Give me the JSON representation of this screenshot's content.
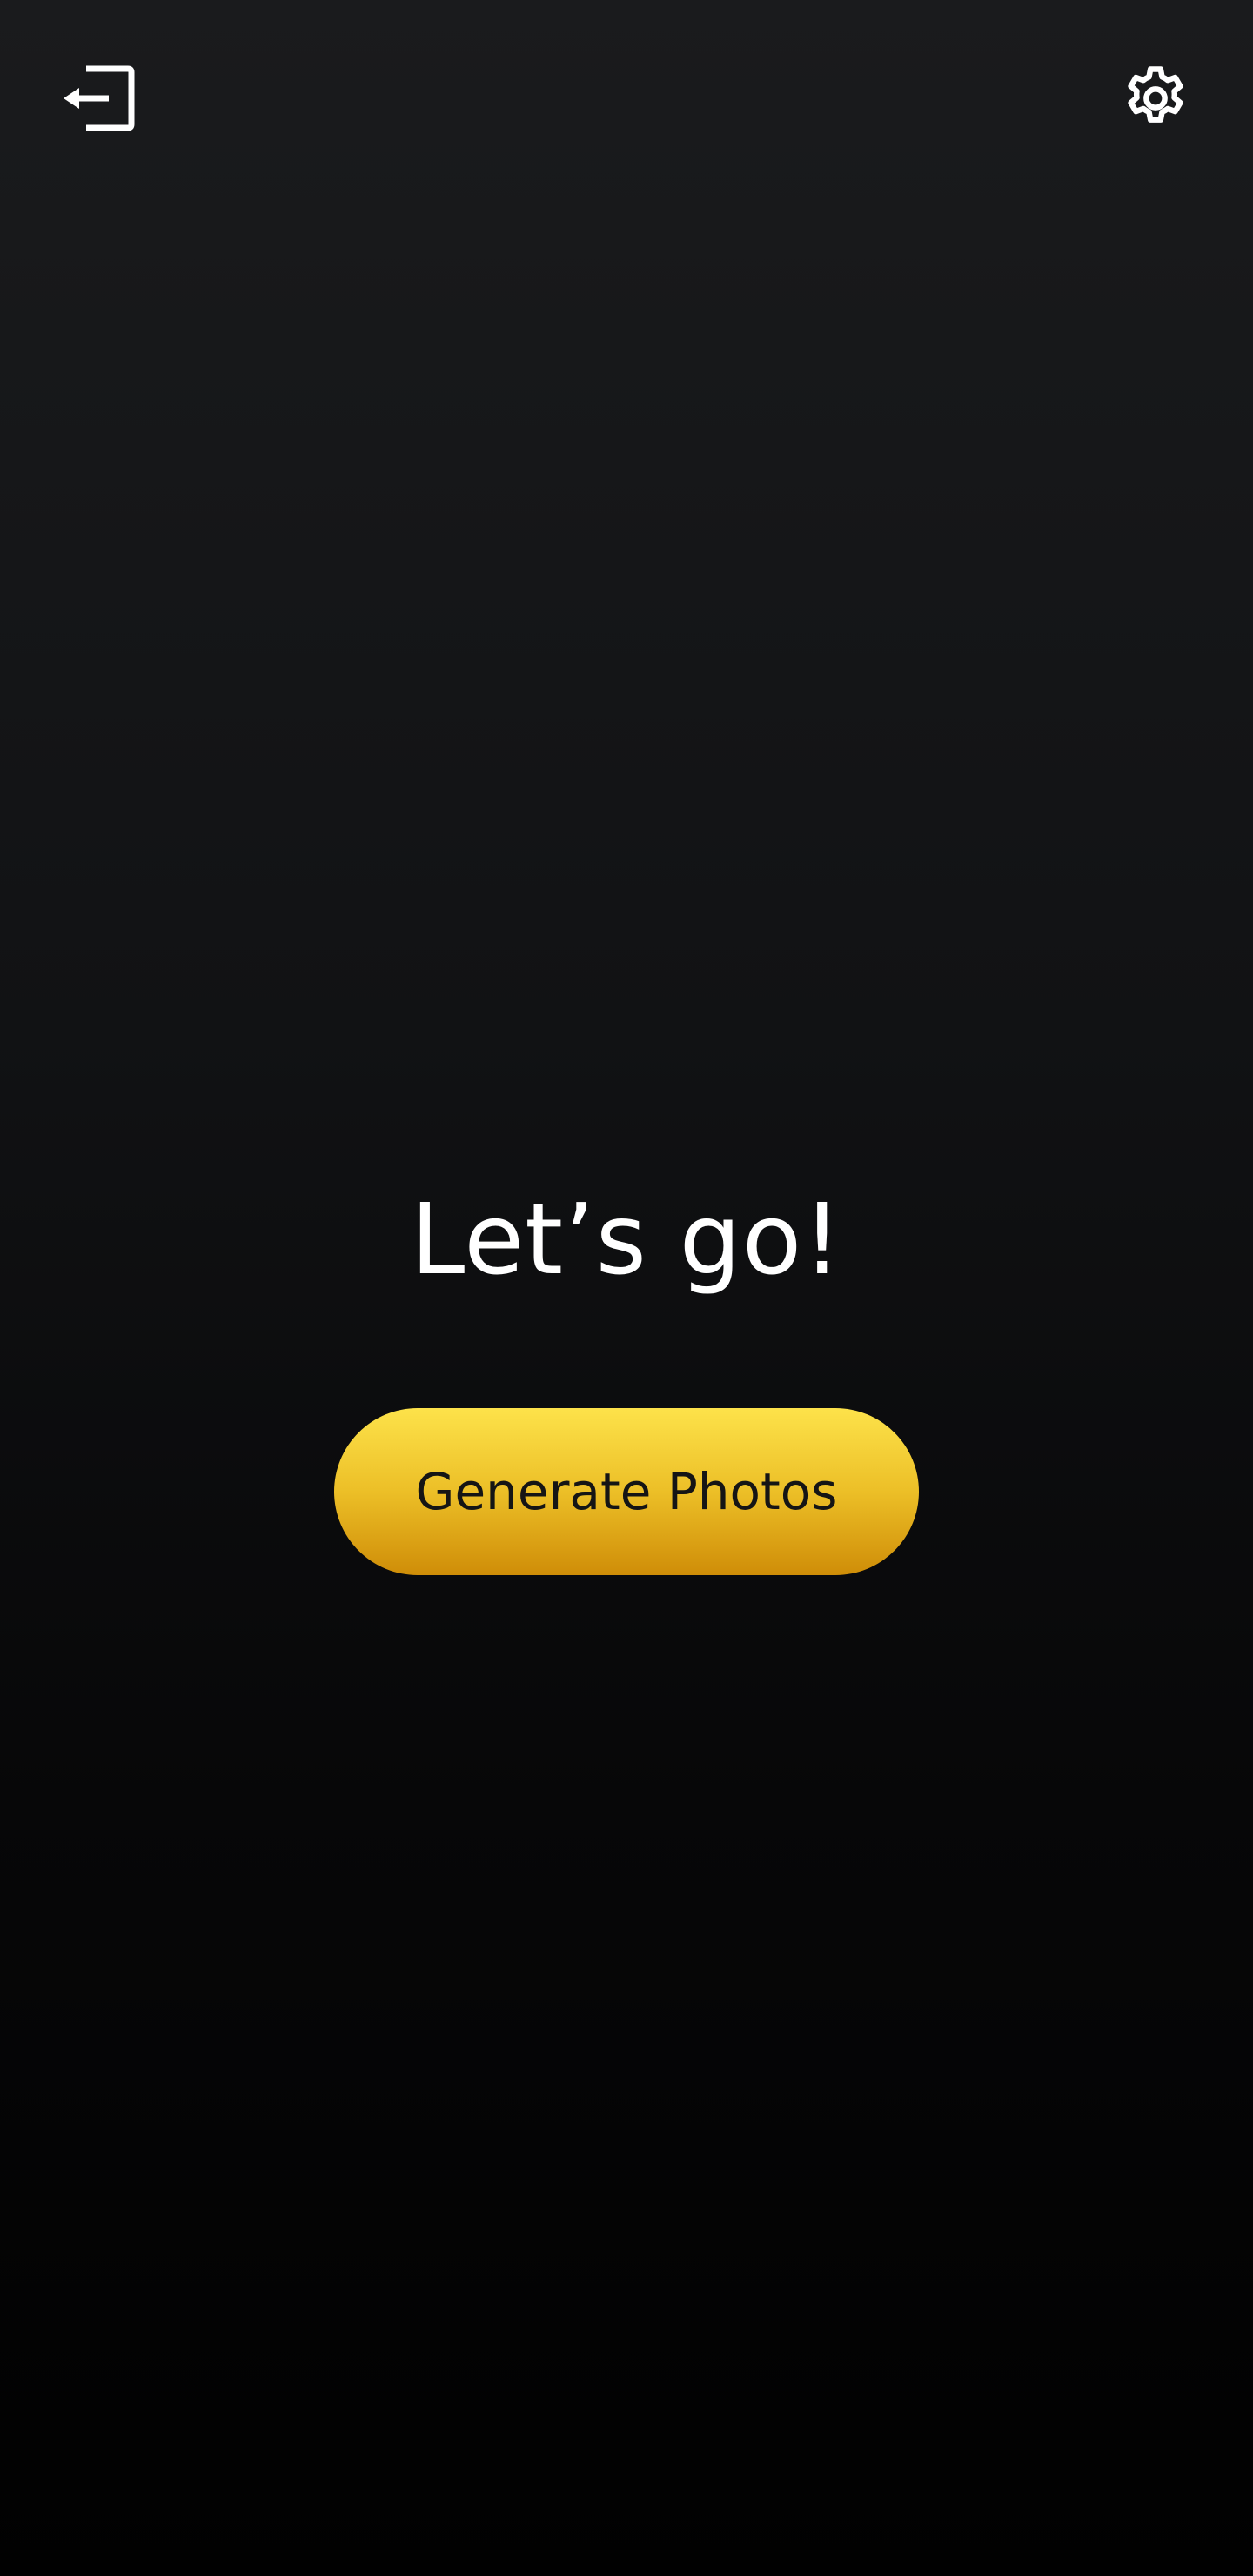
{
  "header": {
    "left_icon": "logout-icon",
    "right_icon": "gear-icon"
  },
  "main": {
    "headline": "Let’s go!",
    "cta_label": "Generate Photos"
  },
  "colors": {
    "background_top": "#1a1b1d",
    "background_bottom": "#010101",
    "cta_gradient_top": "#fde24a",
    "cta_gradient_bottom": "#cf8d08",
    "cta_text": "#151515",
    "headline_text": "#ffffff"
  }
}
